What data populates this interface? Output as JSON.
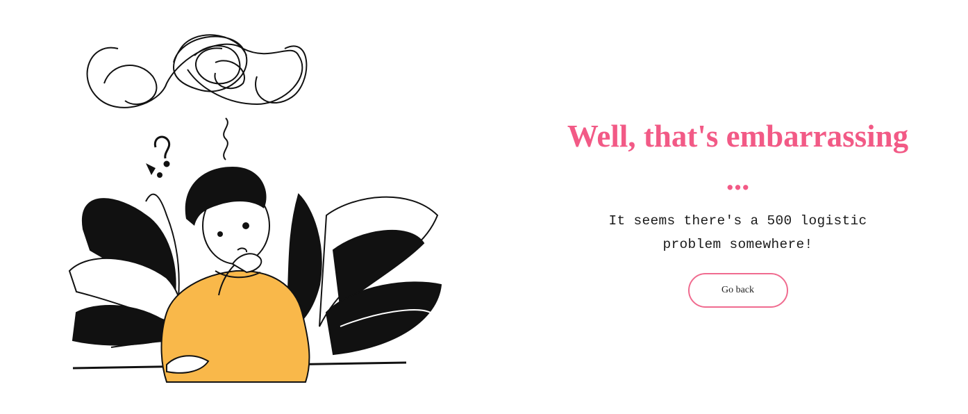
{
  "error": {
    "title": "Well, that's embarrassing ...",
    "message": "It seems there's a 500 logistic problem somewhere!",
    "go_back_label": "Go back"
  },
  "colors": {
    "accent": "#f25a86",
    "sweater": "#f9b84a",
    "ink": "#111111"
  },
  "illustration": {
    "subject": "confused-man-thinking"
  }
}
